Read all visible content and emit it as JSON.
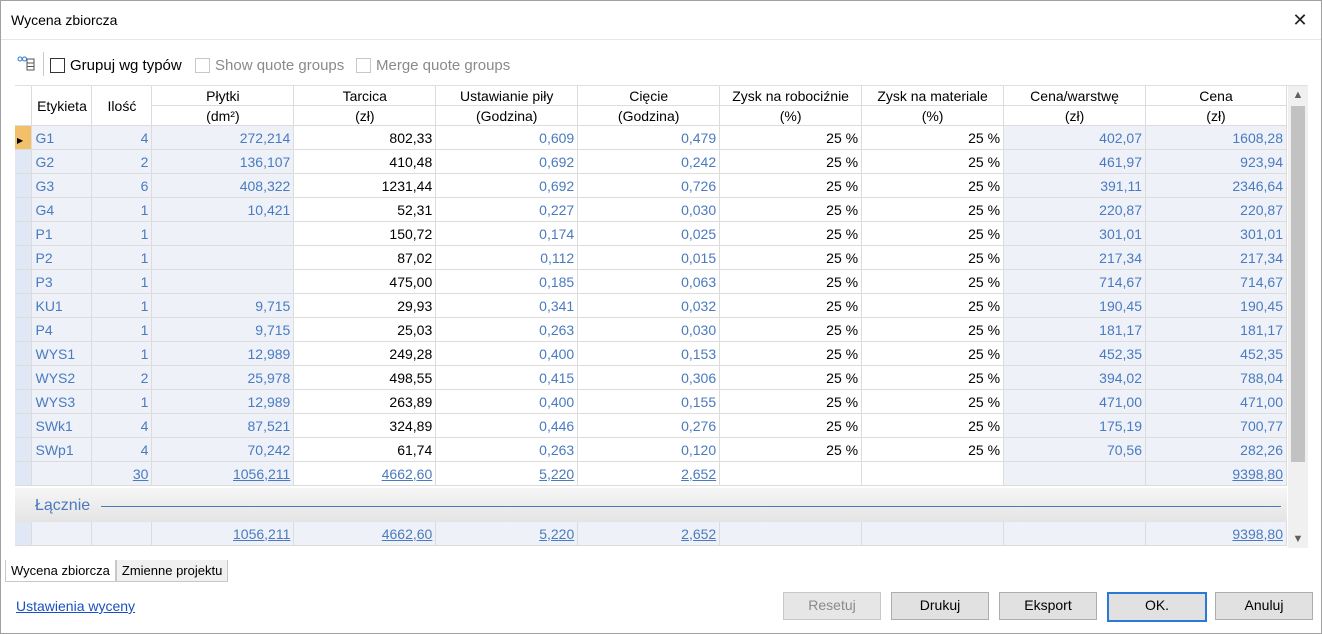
{
  "window": {
    "title": "Wycena zbiorcza",
    "close_glyph": "✕"
  },
  "toolbar": {
    "group_by_types": "Grupuj wg typów",
    "show_quote_groups": "Show quote groups",
    "merge_quote_groups": "Merge quote groups"
  },
  "columns": {
    "label": "Etykieta",
    "qty": "Ilość",
    "panels": [
      "Płytki",
      "(dm²)"
    ],
    "lumber": [
      "Tarcica",
      "(zł)"
    ],
    "setup": [
      "Ustawianie piły",
      "(Godzina)"
    ],
    "cutting": [
      "Cięcie",
      "(Godzina)"
    ],
    "labor_profit": [
      "Zysk na robociźnie",
      "(%)"
    ],
    "material_profit": [
      "Zysk na materiale",
      "(%)"
    ],
    "price_per_layer": [
      "Cena/warstwę",
      "(zł)"
    ],
    "price": [
      "Cena",
      "(zł)"
    ]
  },
  "rows": [
    {
      "label": "G1",
      "qty": "4",
      "panels": "272,214",
      "lumber": "802,33",
      "setup": "0,609",
      "cutting": "0,479",
      "labor": "25 %",
      "material": "25 %",
      "ppl": "402,07",
      "price": "1608,28"
    },
    {
      "label": "G2",
      "qty": "2",
      "panels": "136,107",
      "lumber": "410,48",
      "setup": "0,692",
      "cutting": "0,242",
      "labor": "25 %",
      "material": "25 %",
      "ppl": "461,97",
      "price": "923,94"
    },
    {
      "label": "G3",
      "qty": "6",
      "panels": "408,322",
      "lumber": "1231,44",
      "setup": "0,692",
      "cutting": "0,726",
      "labor": "25 %",
      "material": "25 %",
      "ppl": "391,11",
      "price": "2346,64"
    },
    {
      "label": "G4",
      "qty": "1",
      "panels": "10,421",
      "lumber": "52,31",
      "setup": "0,227",
      "cutting": "0,030",
      "labor": "25 %",
      "material": "25 %",
      "ppl": "220,87",
      "price": "220,87"
    },
    {
      "label": "P1",
      "qty": "1",
      "panels": "",
      "lumber": "150,72",
      "setup": "0,174",
      "cutting": "0,025",
      "labor": "25 %",
      "material": "25 %",
      "ppl": "301,01",
      "price": "301,01"
    },
    {
      "label": "P2",
      "qty": "1",
      "panels": "",
      "lumber": "87,02",
      "setup": "0,112",
      "cutting": "0,015",
      "labor": "25 %",
      "material": "25 %",
      "ppl": "217,34",
      "price": "217,34"
    },
    {
      "label": "P3",
      "qty": "1",
      "panels": "",
      "lumber": "475,00",
      "setup": "0,185",
      "cutting": "0,063",
      "labor": "25 %",
      "material": "25 %",
      "ppl": "714,67",
      "price": "714,67"
    },
    {
      "label": "KU1",
      "qty": "1",
      "panels": "9,715",
      "lumber": "29,93",
      "setup": "0,341",
      "cutting": "0,032",
      "labor": "25 %",
      "material": "25 %",
      "ppl": "190,45",
      "price": "190,45"
    },
    {
      "label": "P4",
      "qty": "1",
      "panels": "9,715",
      "lumber": "25,03",
      "setup": "0,263",
      "cutting": "0,030",
      "labor": "25 %",
      "material": "25 %",
      "ppl": "181,17",
      "price": "181,17"
    },
    {
      "label": "WYS1",
      "qty": "1",
      "panels": "12,989",
      "lumber": "249,28",
      "setup": "0,400",
      "cutting": "0,153",
      "labor": "25 %",
      "material": "25 %",
      "ppl": "452,35",
      "price": "452,35"
    },
    {
      "label": "WYS2",
      "qty": "2",
      "panels": "25,978",
      "lumber": "498,55",
      "setup": "0,415",
      "cutting": "0,306",
      "labor": "25 %",
      "material": "25 %",
      "ppl": "394,02",
      "price": "788,04"
    },
    {
      "label": "WYS3",
      "qty": "1",
      "panels": "12,989",
      "lumber": "263,89",
      "setup": "0,400",
      "cutting": "0,155",
      "labor": "25 %",
      "material": "25 %",
      "ppl": "471,00",
      "price": "471,00"
    },
    {
      "label": "SWk1",
      "qty": "4",
      "panels": "87,521",
      "lumber": "324,89",
      "setup": "0,446",
      "cutting": "0,276",
      "labor": "25 %",
      "material": "25 %",
      "ppl": "175,19",
      "price": "700,77"
    },
    {
      "label": "SWp1",
      "qty": "4",
      "panels": "70,242",
      "lumber": "61,74",
      "setup": "0,263",
      "cutting": "0,120",
      "labor": "25 %",
      "material": "25 %",
      "ppl": "70,56",
      "price": "282,26"
    }
  ],
  "subtotal": {
    "qty": "30",
    "panels": "1056,211",
    "lumber": "4662,60",
    "setup": "5,220",
    "cutting": "2,652",
    "price": "9398,80"
  },
  "group": {
    "label": "Łącznie"
  },
  "total": {
    "panels": "1056,211",
    "lumber": "4662,60",
    "setup": "5,220",
    "cutting": "2,652",
    "price": "9398,80"
  },
  "tabs": [
    "Wycena zbiorcza",
    "Zmienne projektu"
  ],
  "footer": {
    "settings_link": "Ustawienia wyceny",
    "reset": "Resetuj",
    "print": "Drukuj",
    "export": "Eksport",
    "ok": "OK.",
    "cancel": "Anuluj"
  },
  "colors": {
    "link_blue": "#4a7abf",
    "current_row": "#f2c068",
    "primary_border": "#2b79d6"
  },
  "icons": {
    "toolbar": "settings-grid-icon",
    "scroll_up": "chevron-up-icon",
    "scroll_down": "chevron-down-icon"
  }
}
